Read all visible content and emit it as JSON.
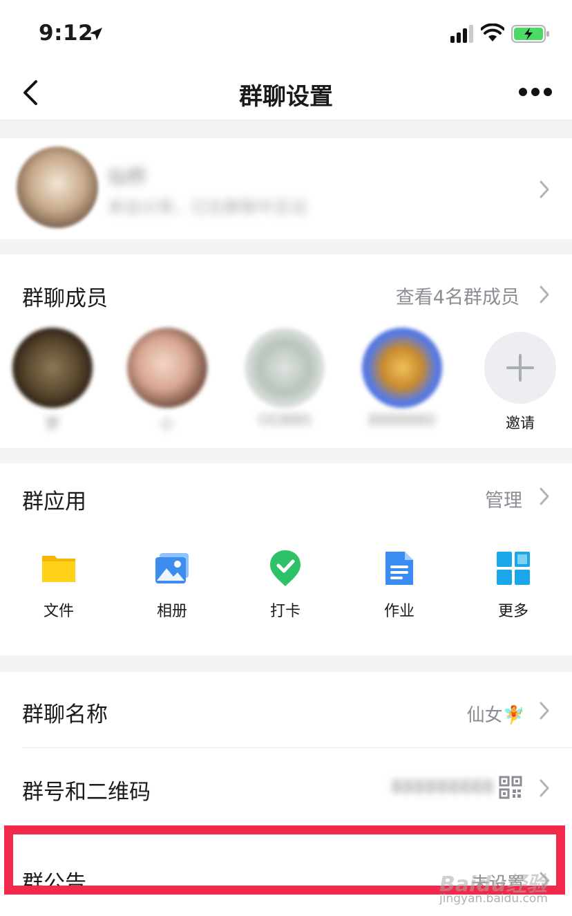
{
  "status_bar": {
    "time": "9:12"
  },
  "nav": {
    "title": "群聊设置"
  },
  "profile": {
    "name": "仙桥",
    "description": "来自分享，已在群聊中互动"
  },
  "members": {
    "title": "群聊成员",
    "view_all": "查看4名群成员",
    "items": [
      {
        "name": "梦"
      },
      {
        "name": "小"
      },
      {
        "name": "OO880"
      },
      {
        "name": "8888880"
      }
    ],
    "invite_label": "邀请"
  },
  "apps": {
    "title": "群应用",
    "manage": "管理",
    "items": [
      {
        "label": "文件",
        "icon": "folder-icon"
      },
      {
        "label": "相册",
        "icon": "photo-album-icon"
      },
      {
        "label": "打卡",
        "icon": "check-in-icon"
      },
      {
        "label": "作业",
        "icon": "homework-icon"
      },
      {
        "label": "更多",
        "icon": "more-apps-icon"
      }
    ]
  },
  "settings": {
    "group_name_label": "群聊名称",
    "group_name_value": "仙女🧚",
    "group_id_label": "群号和二维码",
    "group_id_value": "888888888",
    "announcement_label": "群公告",
    "announcement_value": "未设置"
  },
  "watermark": {
    "brand": "Baidu经验",
    "url": "jingyan.baidu.com"
  },
  "colors": {
    "highlight": "#f2294a",
    "secondary_text": "#8a8d93"
  }
}
